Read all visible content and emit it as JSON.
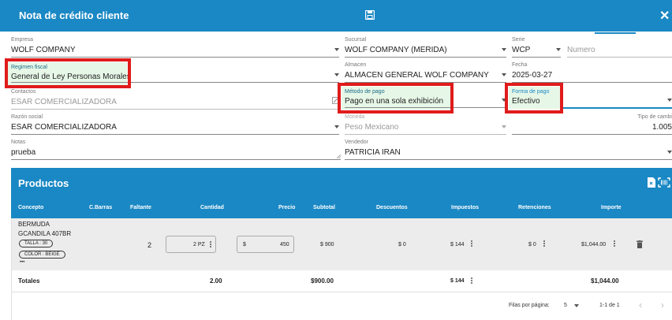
{
  "header": {
    "title": "Nota de crédito cliente"
  },
  "form": {
    "empresa": {
      "label": "Empresa",
      "value": "WOLF COMPANY"
    },
    "sucursal": {
      "label": "Sucursal",
      "value": "WOLF COMPANY (MERIDA)"
    },
    "serie": {
      "label": "Serie",
      "value": "WCP"
    },
    "numero": {
      "placeholder": "Numero"
    },
    "regimen": {
      "label": "Regimen fiscal",
      "value": "General de Ley Personas Morales"
    },
    "almacen": {
      "label": "Almacen",
      "value": "ALMACEN GENERAL WOLF COMPANY"
    },
    "fecha": {
      "label": "Fecha",
      "value": "2025-03-27"
    },
    "contactos": {
      "label": "Contactos",
      "value": "ESAR COMERCIALIZADORA"
    },
    "metodo": {
      "label": "Método de pago",
      "value": "Pago en una sola exhibición"
    },
    "forma": {
      "label": "Forma de pago",
      "value": "Efectivo"
    },
    "razon": {
      "label": "Razón social",
      "value": "ESAR COMERCIALIZADORA"
    },
    "moneda": {
      "label": "Moneda",
      "value": "Peso Mexicano"
    },
    "tipo_cambio": {
      "label": "Tipo de cambi",
      "value": "1.005"
    },
    "notas": {
      "label": "Notas",
      "value": "prueba"
    },
    "vendedor": {
      "label": "Vendedor",
      "value": "PATRICIA IRAN"
    }
  },
  "productos": {
    "title": "Productos",
    "columns": [
      "Concepto",
      "C.Barras",
      "Faltante",
      "Cantidad",
      "Precio",
      "Subtotal",
      "Descuentos",
      "Impuestos",
      "Retenciones",
      "Importe"
    ],
    "row": {
      "concepto_1": "BERMUDA",
      "concepto_2": "GCANDILA 407BR",
      "chip_1": "TALLA : 30",
      "chip_2": "COLOR : BEIGE",
      "more": "•••",
      "faltante": "2",
      "cantidad": "2 PZ",
      "precio_prefix": "$",
      "precio": "450",
      "subtotal": "$ 900",
      "descuentos": "$ 0",
      "impuestos": "$ 144",
      "retenciones": "$ 0",
      "importe": "$1,044.00"
    },
    "totals": {
      "label": "Totales",
      "cantidad": "2.00",
      "subtotal": "$900.00",
      "impuestos": "$ 144",
      "importe": "$1,044.00"
    },
    "footer": {
      "rows_label": "Filas por página:",
      "rows_value": "5",
      "range": "1-1 de 1",
      "prev": "‹",
      "next": "›"
    }
  }
}
